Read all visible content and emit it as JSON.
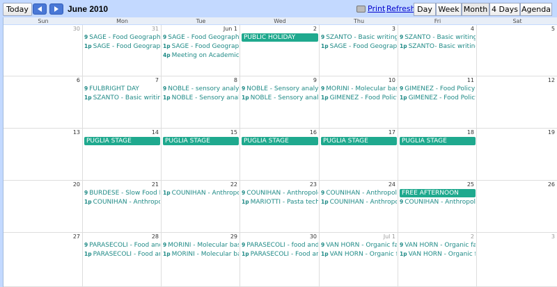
{
  "toolbar": {
    "today_label": "Today",
    "title": "June 2010",
    "print_label": "Print",
    "refresh_label": "Refresh",
    "views": [
      "Day",
      "Week",
      "Month",
      "4 Days",
      "Agenda"
    ],
    "active_view": "Month"
  },
  "days": [
    "Sun",
    "Mon",
    "Tue",
    "Wed",
    "Thu",
    "Fri",
    "Sat"
  ],
  "weeks": [
    {
      "dates": [
        "30",
        "31",
        "Jun 1",
        "2",
        "3",
        "4",
        "5"
      ],
      "other": [
        true,
        true,
        false,
        false,
        false,
        false,
        false
      ]
    },
    {
      "dates": [
        "6",
        "7",
        "8",
        "9",
        "10",
        "11",
        "12"
      ],
      "other": [
        false,
        false,
        false,
        false,
        false,
        false,
        false
      ]
    },
    {
      "dates": [
        "13",
        "14",
        "15",
        "16",
        "17",
        "18",
        "19"
      ],
      "other": [
        false,
        false,
        false,
        false,
        false,
        false,
        false
      ]
    },
    {
      "dates": [
        "20",
        "21",
        "22",
        "23",
        "24",
        "25",
        "26"
      ],
      "other": [
        false,
        false,
        false,
        false,
        false,
        false,
        false
      ]
    },
    {
      "dates": [
        "27",
        "28",
        "29",
        "30",
        "Jul 1",
        "2",
        "3"
      ],
      "other": [
        false,
        false,
        false,
        false,
        true,
        true,
        true
      ]
    }
  ],
  "events": [
    {
      "w": 0,
      "d": 1,
      "slot": 0,
      "time": "9",
      "title": "SAGE - Food Geography"
    },
    {
      "w": 0,
      "d": 1,
      "slot": 1,
      "time": "1p",
      "title": "SAGE - Food Geography"
    },
    {
      "w": 0,
      "d": 2,
      "slot": 0,
      "time": "9",
      "title": "SAGE - Food Geography"
    },
    {
      "w": 0,
      "d": 2,
      "slot": 1,
      "time": "1p",
      "title": "SAGE - Food Geography"
    },
    {
      "w": 0,
      "d": 2,
      "slot": 2,
      "time": "4p",
      "title": "Meeting on Academics"
    },
    {
      "w": 0,
      "d": 4,
      "slot": 0,
      "time": "9",
      "title": "SZANTO - Basic writing"
    },
    {
      "w": 0,
      "d": 4,
      "slot": 1,
      "time": "1p",
      "title": "SAGE - Food Geography"
    },
    {
      "w": 0,
      "d": 5,
      "slot": 0,
      "time": "9",
      "title": "SZANTO - Basic writing"
    },
    {
      "w": 0,
      "d": 5,
      "slot": 1,
      "time": "1p",
      "title": "SZANTO- Basic writing"
    },
    {
      "w": 1,
      "d": 1,
      "slot": 0,
      "time": "9",
      "title": "FULBRIGHT DAY"
    },
    {
      "w": 1,
      "d": 1,
      "slot": 1,
      "time": "1p",
      "title": "SZANTO - Basic writing"
    },
    {
      "w": 1,
      "d": 2,
      "slot": 0,
      "time": "9",
      "title": "NOBLE - sensory analysis"
    },
    {
      "w": 1,
      "d": 2,
      "slot": 1,
      "time": "1p",
      "title": "NOBLE - Sensory analysis"
    },
    {
      "w": 1,
      "d": 3,
      "slot": 0,
      "time": "9",
      "title": "NOBLE - Sensory analysis"
    },
    {
      "w": 1,
      "d": 3,
      "slot": 1,
      "time": "1p",
      "title": "NOBLE - Sensory analysis"
    },
    {
      "w": 1,
      "d": 4,
      "slot": 0,
      "time": "9",
      "title": "MORINI - Molecular basis"
    },
    {
      "w": 1,
      "d": 4,
      "slot": 1,
      "time": "1p",
      "title": "GIMENEZ - Food Policy"
    },
    {
      "w": 1,
      "d": 5,
      "slot": 0,
      "time": "9",
      "title": "GIMENEZ - Food Policy"
    },
    {
      "w": 1,
      "d": 5,
      "slot": 1,
      "time": "1p",
      "title": "GIMENEZ - Food Policy"
    },
    {
      "w": 3,
      "d": 1,
      "slot": 0,
      "time": "9",
      "title": "BURDESE - Slow Food Il"
    },
    {
      "w": 3,
      "d": 1,
      "slot": 1,
      "time": "1p",
      "title": "COUNIHAN - Anthropology"
    },
    {
      "w": 3,
      "d": 2,
      "slot": 0,
      "time": "1p",
      "title": "COUNIHAN - Anthropology"
    },
    {
      "w": 3,
      "d": 3,
      "slot": 0,
      "time": "9",
      "title": "COUNIHAN - Anthropology"
    },
    {
      "w": 3,
      "d": 3,
      "slot": 1,
      "time": "1p",
      "title": "MARIOTTI - Pasta techn"
    },
    {
      "w": 3,
      "d": 4,
      "slot": 0,
      "time": "9",
      "title": "COUNIHAN - Anthropology"
    },
    {
      "w": 3,
      "d": 4,
      "slot": 1,
      "time": "1p",
      "title": "COUNIHAN - Anthropology"
    },
    {
      "w": 3,
      "d": 5,
      "slot": 1,
      "time": "9",
      "title": "COUNIHAN - Anthropology"
    },
    {
      "w": 4,
      "d": 1,
      "slot": 0,
      "time": "9",
      "title": "PARASECOLI - Food and"
    },
    {
      "w": 4,
      "d": 1,
      "slot": 1,
      "time": "1p",
      "title": "PARASECOLI - Food and"
    },
    {
      "w": 4,
      "d": 2,
      "slot": 0,
      "time": "9",
      "title": "MORINI - Molecular basis"
    },
    {
      "w": 4,
      "d": 2,
      "slot": 1,
      "time": "1p",
      "title": "MORINI - Molecular basis"
    },
    {
      "w": 4,
      "d": 3,
      "slot": 0,
      "time": "9",
      "title": "PARASECOLI - food and"
    },
    {
      "w": 4,
      "d": 3,
      "slot": 1,
      "time": "1p",
      "title": "PARASECOLI - Food and"
    },
    {
      "w": 4,
      "d": 4,
      "slot": 0,
      "time": "9",
      "title": "VAN HORN - Organic farm"
    },
    {
      "w": 4,
      "d": 4,
      "slot": 1,
      "time": "1p",
      "title": "VAN HORN - Organic farm"
    },
    {
      "w": 4,
      "d": 5,
      "slot": 0,
      "time": "9",
      "title": "VAN HORN - Organic farm"
    },
    {
      "w": 4,
      "d": 5,
      "slot": 1,
      "time": "1p",
      "title": "VAN HORN - Organic farm"
    }
  ],
  "bars": [
    {
      "w": 0,
      "d": 3,
      "slot": 0,
      "title": "PUBLIC HOLIDAY"
    },
    {
      "w": 2,
      "d": 1,
      "slot": 0,
      "title": "PUGLIA STAGE"
    },
    {
      "w": 2,
      "d": 2,
      "slot": 0,
      "title": "PUGLIA STAGE"
    },
    {
      "w": 2,
      "d": 3,
      "slot": 0,
      "title": "PUGLIA STAGE"
    },
    {
      "w": 2,
      "d": 4,
      "slot": 0,
      "title": "PUGLIA STAGE"
    },
    {
      "w": 2,
      "d": 5,
      "slot": 0,
      "title": "PUGLIA STAGE"
    },
    {
      "w": 3,
      "d": 5,
      "slot": 0,
      "title": "FREE AFTERNOON"
    }
  ],
  "colors": {
    "event_text": "#1f8a86",
    "bar_bg": "#1fa98e",
    "toolbar_bg": "#c3d9ff"
  }
}
